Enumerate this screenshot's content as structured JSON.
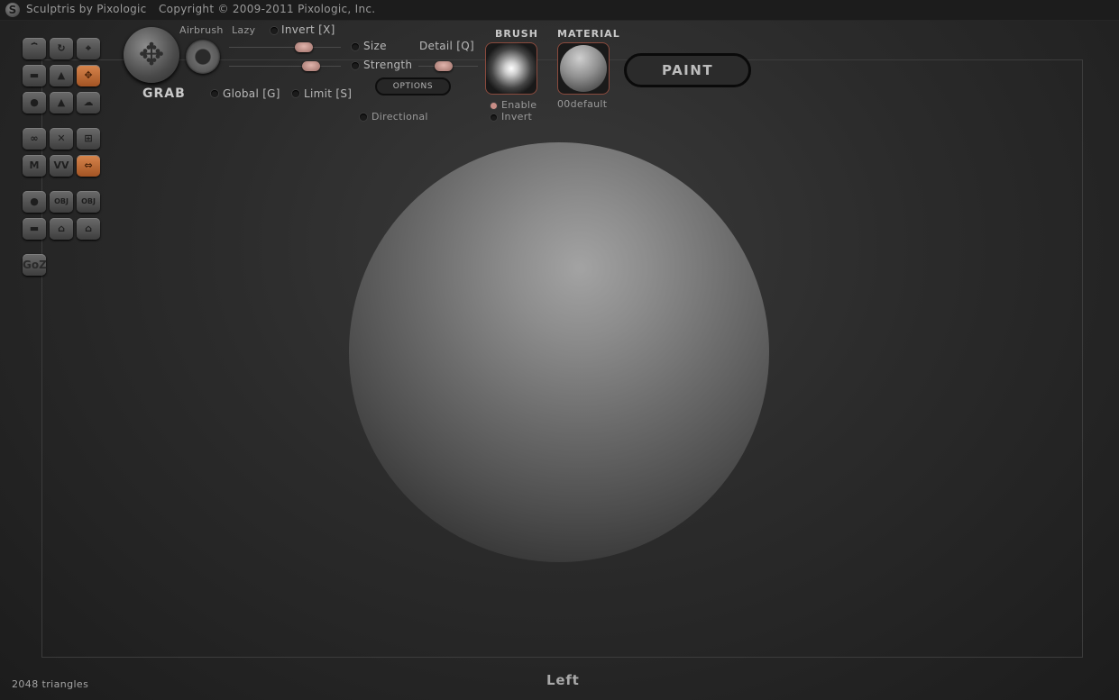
{
  "title_bar": {
    "logo": "S",
    "app": "Sculptris by Pixologic",
    "copyright": "Copyright © 2009-2011 Pixologic, Inc."
  },
  "tools": {
    "rows": [
      [
        "crease-icon",
        "rotate-icon",
        "crop-icon"
      ],
      [
        "flatten-icon",
        "inflate-icon",
        "grab-icon"
      ],
      [
        "pinch-icon",
        "draw-icon",
        "smooth-icon"
      ],
      [
        "brush-icon",
        "pinch-x-icon",
        "grid-icon"
      ],
      [
        "mask-icon",
        "reduce-icon",
        "symmetry-icon"
      ],
      [
        "sphere-icon",
        "import-obj-icon",
        "export-obj-icon"
      ],
      [
        "plane-icon",
        "open-icon",
        "save-icon"
      ]
    ],
    "tool_text": {
      "mask": "M",
      "reduce": "VV",
      "import_obj": "OBJ",
      "export_obj": "OBJ",
      "goz": "GoZ"
    },
    "active": [
      "grab-icon",
      "symmetry-icon"
    ],
    "accent_color": "#c8703a"
  },
  "grab_panel": {
    "tool_name": "GRAB",
    "airbrush_label": "Airbrush",
    "lazy_label": "Lazy",
    "invert_label": "Invert [X]",
    "size_label": "Size",
    "strength_label": "Strength",
    "detail_label": "Detail [Q]",
    "global_label": "Global [G]",
    "limit_label": "Limit [S]",
    "options_label": "OPTIONS",
    "directional_label": "Directional",
    "size_value": 0.68,
    "strength_value": 0.72,
    "detail_value": 0.45
  },
  "brush_panel": {
    "heading": "BRUSH",
    "enable_label": "Enable",
    "invert_label": "Invert",
    "enable_on": true,
    "invert_on": false
  },
  "material_panel": {
    "heading": "MATERIAL",
    "name": "00default"
  },
  "paint_button": {
    "label": "PAINT"
  },
  "status": {
    "triangles": "2048 triangles",
    "view": "Left"
  }
}
